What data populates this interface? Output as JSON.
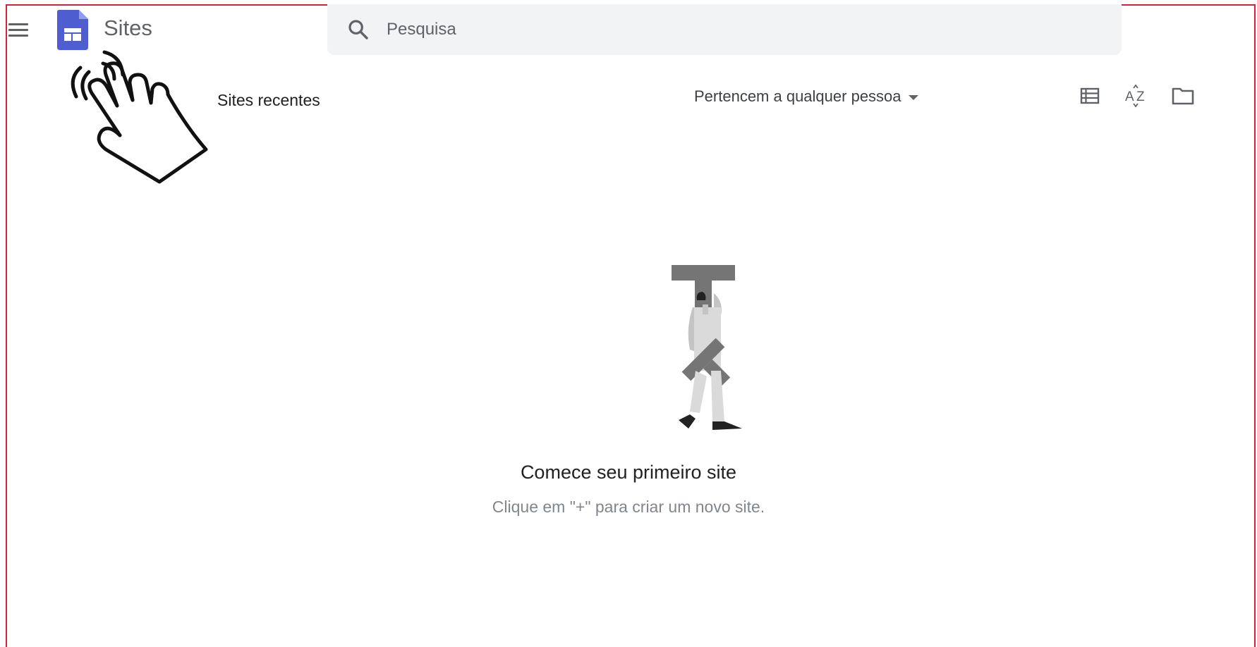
{
  "header": {
    "app_title": "Sites",
    "menu_icon": "hamburger-menu-icon",
    "logo_icon": "google-sites-logo",
    "brand_color": "#4e5ed1"
  },
  "search": {
    "placeholder": "Pesquisa",
    "icon": "search-icon"
  },
  "toolbar": {
    "section_title": "Sites recentes",
    "owner_filter_label": "Pertencem a qualquer pessoa",
    "list_view_icon": "list-view-icon",
    "sort_icon": "sort-az-icon",
    "folder_icon": "folder-icon"
  },
  "empty_state": {
    "title": "Comece seu primeiro site",
    "subtitle": "Clique em \"+\" para criar um novo site."
  },
  "overlay": {
    "pointer_icon": "tap-hand-icon"
  },
  "colors": {
    "frame_border": "#d0243c",
    "search_bg": "#f1f3f4",
    "icon_grey": "#5f6368"
  }
}
